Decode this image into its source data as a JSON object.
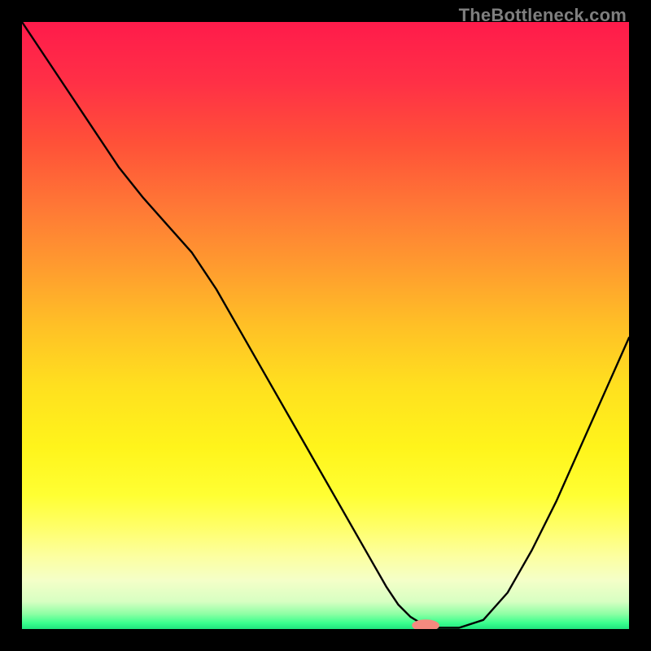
{
  "watermark": "TheBottleneck.com",
  "colors": {
    "bg": "#000000",
    "stroke": "#000000",
    "marker_fill": "#f48a7f",
    "marker_stroke": "#f48a7f",
    "gradient_stops": [
      {
        "offset": 0.0,
        "color": "#ff1b4b"
      },
      {
        "offset": 0.1,
        "color": "#ff3046"
      },
      {
        "offset": 0.2,
        "color": "#ff5138"
      },
      {
        "offset": 0.3,
        "color": "#ff7636"
      },
      {
        "offset": 0.4,
        "color": "#ff9a2f"
      },
      {
        "offset": 0.5,
        "color": "#ffc026"
      },
      {
        "offset": 0.6,
        "color": "#ffe01f"
      },
      {
        "offset": 0.7,
        "color": "#fff41b"
      },
      {
        "offset": 0.78,
        "color": "#ffff33"
      },
      {
        "offset": 0.83,
        "color": "#ffff66"
      },
      {
        "offset": 0.88,
        "color": "#fcffa0"
      },
      {
        "offset": 0.92,
        "color": "#f4ffc8"
      },
      {
        "offset": 0.955,
        "color": "#d7ffc2"
      },
      {
        "offset": 0.975,
        "color": "#8effa4"
      },
      {
        "offset": 0.99,
        "color": "#3aff8e"
      },
      {
        "offset": 1.0,
        "color": "#20e47e"
      }
    ]
  },
  "chart_data": {
    "type": "line",
    "title": "",
    "xlabel": "",
    "ylabel": "",
    "xlim": [
      0,
      100
    ],
    "ylim": [
      0,
      100
    ],
    "x": [
      0,
      4,
      8,
      12,
      16,
      20,
      24,
      28,
      32,
      36,
      40,
      44,
      48,
      52,
      56,
      58,
      60,
      62,
      64,
      66,
      68,
      72,
      76,
      80,
      84,
      88,
      92,
      96,
      100
    ],
    "values": [
      100,
      94,
      88,
      82,
      76,
      71,
      66.5,
      62,
      56,
      49,
      42,
      35,
      28,
      21,
      14,
      10.5,
      7,
      4,
      2,
      0.8,
      0.2,
      0.2,
      1.5,
      6,
      13,
      21,
      30,
      39,
      48
    ],
    "marker": {
      "x": 66.5,
      "y": 0.6,
      "rx": 2.2,
      "ry": 0.9
    },
    "note": "x is 0-100 horizontal %, values are 0-100 vertical % (top to bottom); curve read off the image, approximate"
  }
}
